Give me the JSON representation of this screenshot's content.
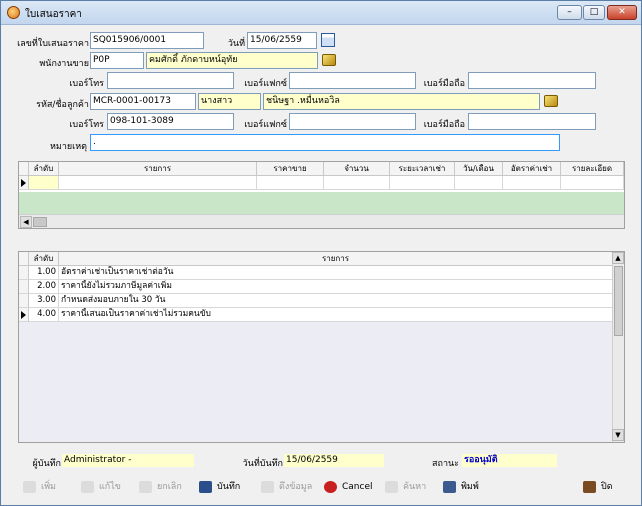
{
  "window": {
    "title": "ใบเสนอราคา",
    "minimize": "–",
    "maximize": "□",
    "close": "✕"
  },
  "form": {
    "quote_no_label": "เลขที่ใบเสนอราคา",
    "quote_no": "SQ015906/0001",
    "date_label": "วันที่",
    "date": "15/06/2559",
    "salesman_label": "พนักงานขาย",
    "salesman_code": "P0P",
    "salesman_name": "คมศักดิ์ ภักดาบหน์อุทัย",
    "phone_label": "เบอร์โทร",
    "fax_label": "เบอร์แฟกซ์",
    "mobile_label": "เบอร์มือถือ",
    "customer_label": "รหัส/ชื่อลูกค้า",
    "customer_code": "MCR-0001-00173",
    "customer_title": "นางสาว",
    "customer_name": "ชนิษฐา .หมื่นหอวิล",
    "customer_phone": "098-101-3089",
    "note_label": "หมายเหตุ",
    "note_value": "."
  },
  "items_grid": {
    "headers": [
      "ลำดับ",
      "รายการ",
      "ราคาขาย",
      "จำนวน",
      "ระยะเวลาเช่า",
      "วัน/เดือน",
      "อัตราค่าเช่า",
      "รายละเอียด"
    ]
  },
  "terms_grid": {
    "headers": [
      "ลำดับ",
      "รายการ"
    ],
    "rows": [
      {
        "no": "1.00",
        "text": "อัตราค่าเช่าเป็นราคาเช่าต่อวัน"
      },
      {
        "no": "2.00",
        "text": "ราคานี้ยังไม่รวมภาษีมูลค่าเพิ่ม"
      },
      {
        "no": "3.00",
        "text": "กำหนดส่งมอบภายใน 30 วัน"
      },
      {
        "no": "4.00",
        "text": "ราคานี้เสนอเป็นราคาค่าเช่าไม่รวมคนขับ"
      }
    ]
  },
  "status": {
    "recorder_label": "ผู้บันทึก",
    "recorder": "Administrator -",
    "record_date_label": "วันที่บันทึก",
    "record_date": "15/06/2559",
    "state_label": "สถานะ",
    "state": "รออนุมัติ",
    "state_color": "#0000cc"
  },
  "toolbar": {
    "add": "เพิ่ม",
    "edit": "แก้ไข",
    "cancel_doc": "ยกเลิก",
    "save": "บันทึก",
    "fetch": "ดึงข้อมูล",
    "cancel": "Cancel",
    "search": "ค้นหา",
    "print": "พิมพ์",
    "close": "ปิด"
  }
}
